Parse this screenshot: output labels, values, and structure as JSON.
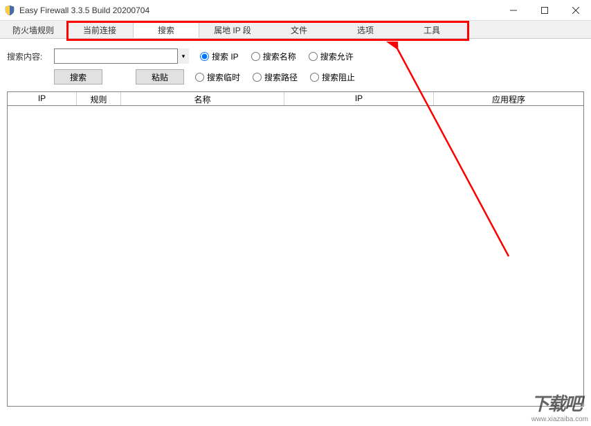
{
  "window": {
    "title": "Easy Firewall 3.3.5 Build 20200704"
  },
  "tabs": [
    "防火墙规则",
    "当前连接",
    "搜索",
    "属地 IP 段",
    "文件",
    "选项",
    "工具"
  ],
  "activeTab": 2,
  "search": {
    "label": "搜索内容:",
    "value": "",
    "searchBtn": "搜索",
    "pasteBtn": "粘贴"
  },
  "radiosRow1": [
    {
      "label": "搜索 IP",
      "checked": true
    },
    {
      "label": "搜索名称",
      "checked": false
    },
    {
      "label": "搜索允许",
      "checked": false
    }
  ],
  "radiosRow2": [
    {
      "label": "搜索临时",
      "checked": false
    },
    {
      "label": "搜索路径",
      "checked": false
    },
    {
      "label": "搜索阻止",
      "checked": false
    }
  ],
  "columns": [
    "IP",
    "规则",
    "名称",
    "IP",
    "应用程序"
  ],
  "watermark": {
    "logo": "下载吧",
    "url": "www.xiazaiba.com"
  }
}
